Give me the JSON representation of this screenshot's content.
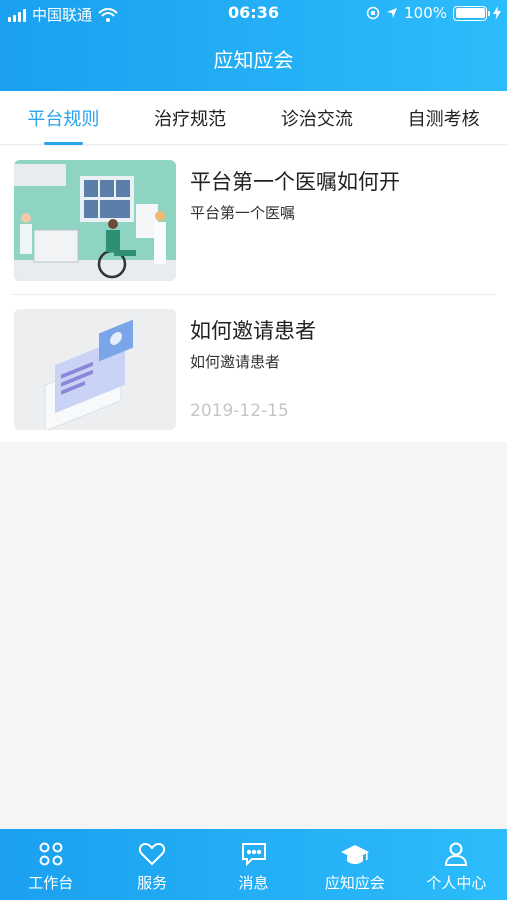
{
  "status_bar": {
    "carrier": "中国联通",
    "time": "06:36",
    "battery": "100%"
  },
  "header": {
    "title": "应知应会"
  },
  "tabs": [
    {
      "label": "平台规则",
      "active": true
    },
    {
      "label": "治疗规范",
      "active": false
    },
    {
      "label": "诊治交流",
      "active": false
    },
    {
      "label": "自测考核",
      "active": false
    }
  ],
  "articles": [
    {
      "title": "平台第一个医嘱如何开",
      "subtitle": "平台第一个医嘱",
      "date": ""
    },
    {
      "title": "如何邀请患者",
      "subtitle": "如何邀请患者",
      "date": "2019-12-15"
    }
  ],
  "tabbar": [
    {
      "label": "工作台",
      "icon": "grid-icon"
    },
    {
      "label": "服务",
      "icon": "heart-icon"
    },
    {
      "label": "消息",
      "icon": "message-icon"
    },
    {
      "label": "应知应会",
      "icon": "graduation-cap-icon",
      "active": true
    },
    {
      "label": "个人中心",
      "icon": "person-icon"
    }
  ],
  "colors": {
    "primary": "#1aa0ef",
    "active_tab": "#2aa4ea"
  }
}
